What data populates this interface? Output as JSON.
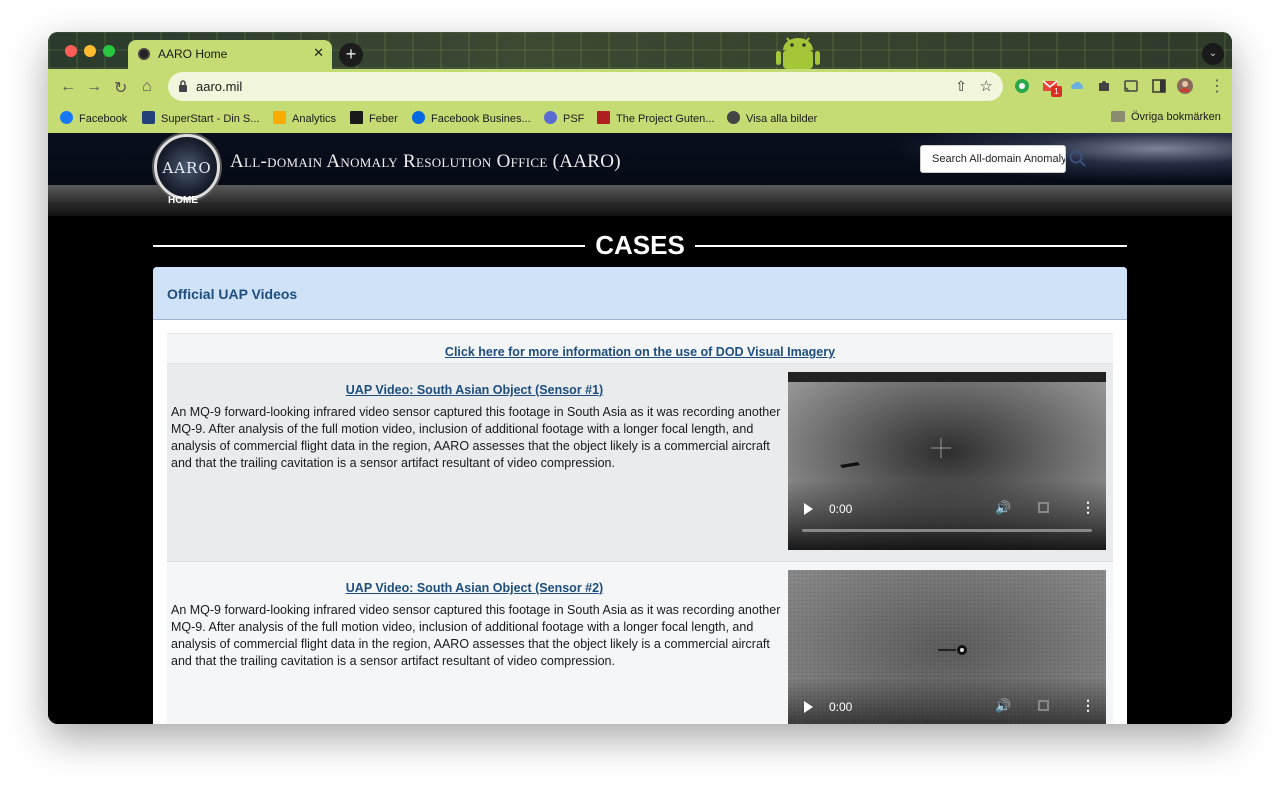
{
  "browser": {
    "tab_title": "AARO Home",
    "tab_close": "✕",
    "new_tab": "+",
    "tab_menu": "⌄",
    "back": "←",
    "forward": "→",
    "reload": "↻",
    "home": "⌂",
    "url": "aaro.mil",
    "share": "⇧",
    "star": "☆",
    "extension_badge": "1",
    "kebab": "⋮",
    "colors": {
      "chrome_green": "#c5dc74",
      "omnibox": "#f2f6dc",
      "tabstrip_dark": "#2f3b2a"
    }
  },
  "bookmarks": {
    "items": [
      {
        "label": "Facebook",
        "icon": "facebook-icon"
      },
      {
        "label": "SuperStart - Din S...",
        "icon": "superstart-icon"
      },
      {
        "label": "Analytics",
        "icon": "analytics-icon"
      },
      {
        "label": "Feber",
        "icon": "feber-icon"
      },
      {
        "label": "Facebook Busines...",
        "icon": "meta-icon"
      },
      {
        "label": "PSF",
        "icon": "psf-icon"
      },
      {
        "label": "The Project Guten...",
        "icon": "gutenberg-icon"
      },
      {
        "label": "Visa alla bilder",
        "icon": "globe-icon"
      }
    ],
    "other": "Övriga bokmärken"
  },
  "site": {
    "seal_text": "AARO",
    "title": "All-domain Anomaly Resolution Office (AARO)",
    "nav_home": "HOME",
    "search_placeholder": "Search All-domain Anomaly",
    "search_icon": "⌕"
  },
  "main": {
    "heading": "CASES",
    "panel_title": "Official UAP Videos",
    "info_link": "Click here for more information on the use of DOD Visual Imagery",
    "videos": [
      {
        "title": "UAP Video: South Asian Object (Sensor #1)",
        "description": "An MQ-9 forward-looking infrared video sensor captured this footage in South Asia as it was recording another MQ-9. After analysis of the full motion video, inclusion of additional footage with a longer focal length, and analysis of commercial flight data in the region, AARO assesses that the object likely is a commercial aircraft and that the trailing cavitation is a sensor artifact resultant of video compression.",
        "time": "0:00"
      },
      {
        "title": "UAP Video: South Asian Object (Sensor #2)",
        "description": "An MQ-9 forward-looking infrared video sensor captured this footage in South Asia as it was recording another MQ-9. After analysis of the full motion video, inclusion of additional footage with a longer focal length, and analysis of commercial flight data in the region, AARO assesses that the object likely is a commercial aircraft and that the trailing cavitation is a sensor artifact resultant of video compression.",
        "time": "0:00"
      }
    ],
    "video_controls": {
      "volume": "🔊",
      "more": "⋮"
    },
    "colors": {
      "link": "#1d4e7e",
      "panel_header": "#cfe2f7"
    }
  }
}
